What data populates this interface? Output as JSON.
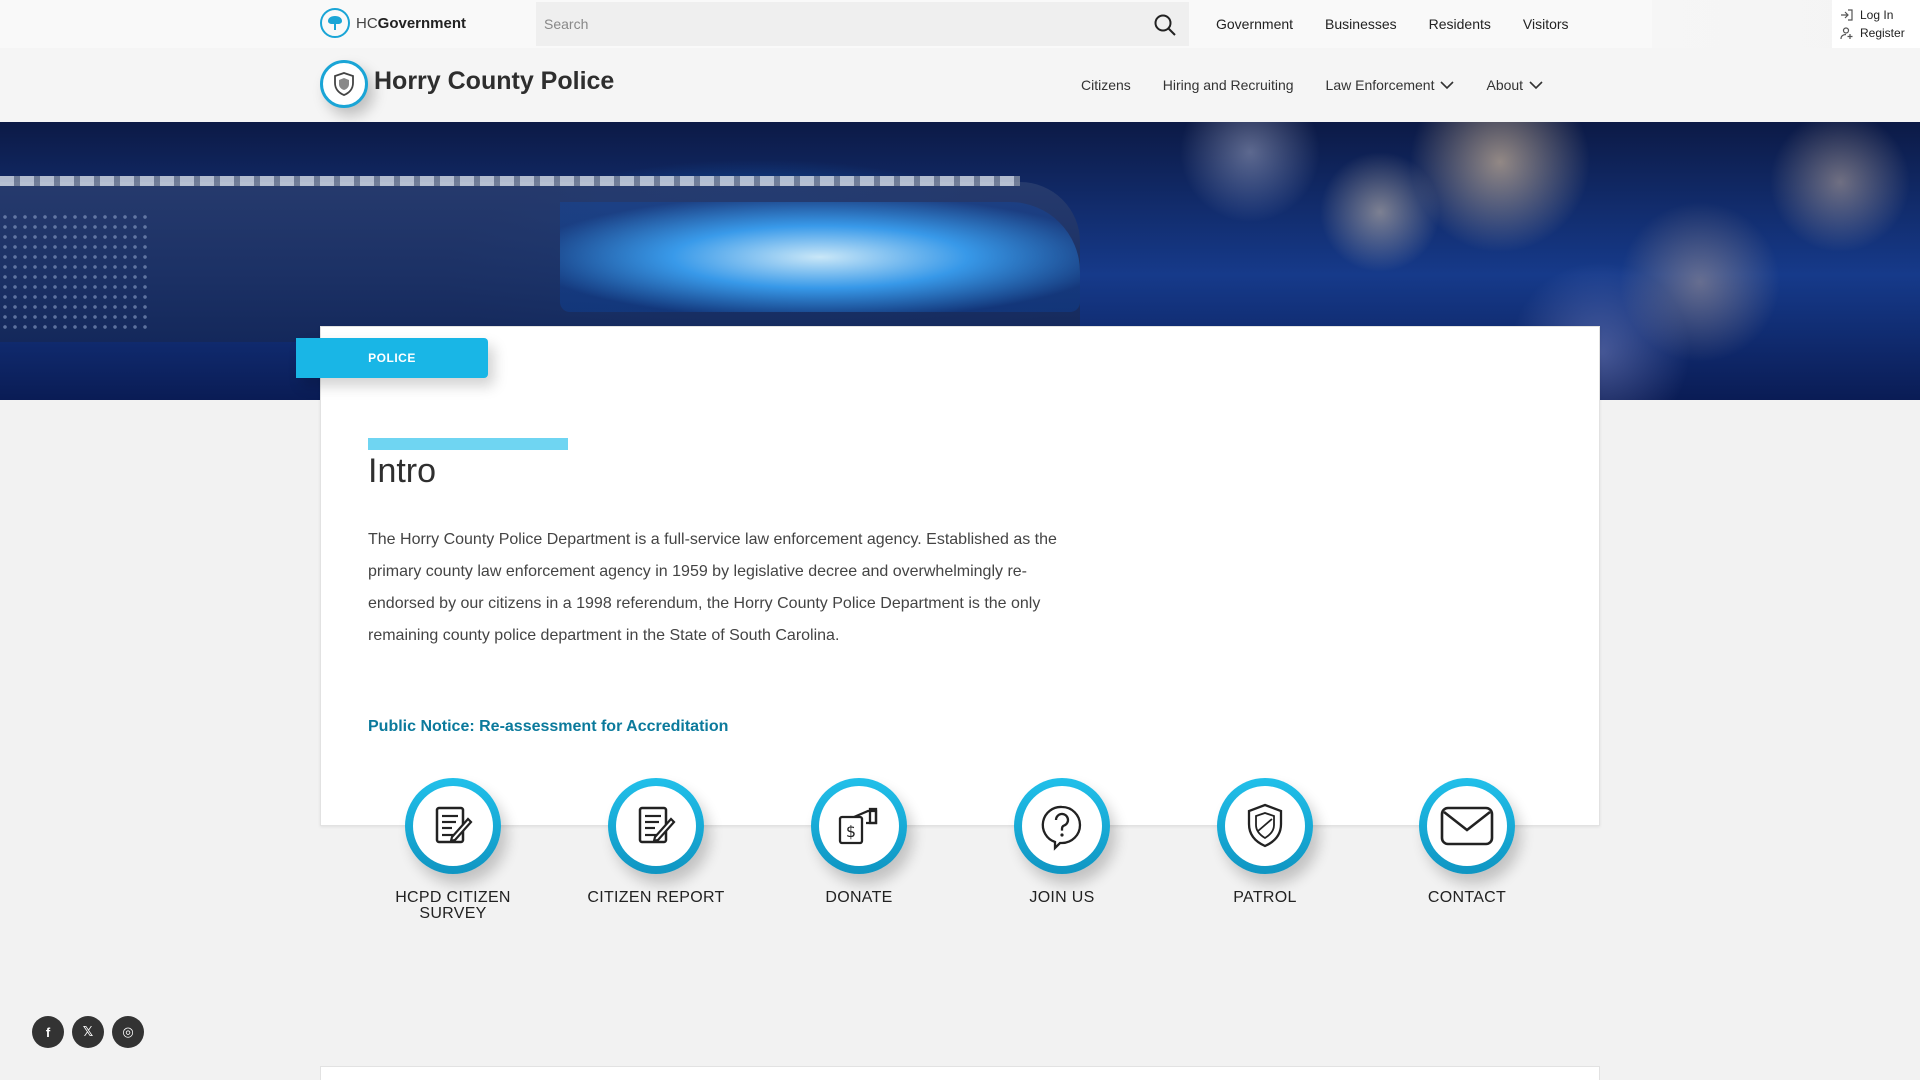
{
  "topbar": {
    "brand_prefix": "HC",
    "brand_name": "Government",
    "search_placeholder": "Search",
    "nav": [
      "Government",
      "Businesses",
      "Residents",
      "Visitors"
    ],
    "login": "Log In",
    "register": "Register"
  },
  "header": {
    "title": "Horry County Police",
    "nav": [
      {
        "label": "Citizens",
        "has_dropdown": false
      },
      {
        "label": "Hiring and Recruiting",
        "has_dropdown": false
      },
      {
        "label": "Law Enforcement",
        "has_dropdown": true
      },
      {
        "label": "About",
        "has_dropdown": true
      }
    ]
  },
  "main": {
    "tag": "POLICE",
    "title": "Intro",
    "body": "The Horry County Police Department is a full-service law enforcement agency. Established as the primary county law enforcement agency in 1959 by legislative decree and overwhelmingly re-endorsed by our citizens in a 1998 referendum, the Horry County Police Department is the only remaining county police department in the State of South Carolina.",
    "notice_link": "Public Notice: Re-assessment for Accreditation"
  },
  "quick_links": [
    {
      "label_line1": "HCPD CITIZEN",
      "label_line2": "SURVEY",
      "icon": "survey-icon"
    },
    {
      "label_line1": "CITIZEN REPORT",
      "label_line2": "",
      "icon": "report-icon"
    },
    {
      "label_line1": "DONATE",
      "label_line2": "",
      "icon": "donate-icon"
    },
    {
      "label_line1": "JOIN US",
      "label_line2": "",
      "icon": "question-icon"
    },
    {
      "label_line1": "PATROL",
      "label_line2": "",
      "icon": "shield-icon"
    },
    {
      "label_line1": "CONTACT",
      "label_line2": "",
      "icon": "envelope-icon"
    }
  ],
  "social": {
    "facebook": "f",
    "x": "𝕏",
    "instagram": "◎"
  },
  "colors": {
    "accent": "#19b6e6",
    "accent_light": "#6fd5f2",
    "link": "#0b7a9c"
  }
}
